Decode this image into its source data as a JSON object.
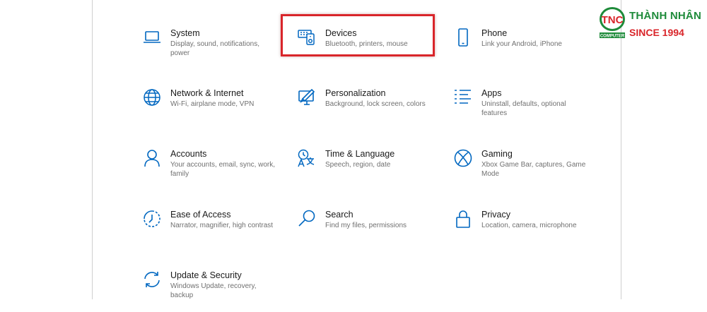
{
  "settings": {
    "items": [
      {
        "title": "System",
        "subtitle": "Display, sound, notifications, power",
        "icon": "laptop-icon"
      },
      {
        "title": "Devices",
        "subtitle": "Bluetooth, printers, mouse",
        "icon": "devices-icon"
      },
      {
        "title": "Phone",
        "subtitle": "Link your Android, iPhone",
        "icon": "phone-icon"
      },
      {
        "title": "Network & Internet",
        "subtitle": "Wi-Fi, airplane mode, VPN",
        "icon": "globe-icon"
      },
      {
        "title": "Personalization",
        "subtitle": "Background, lock screen, colors",
        "icon": "paint-brush-icon"
      },
      {
        "title": "Apps",
        "subtitle": "Uninstall, defaults, optional features",
        "icon": "apps-list-icon"
      },
      {
        "title": "Accounts",
        "subtitle": "Your accounts, email, sync, work, family",
        "icon": "person-icon"
      },
      {
        "title": "Time & Language",
        "subtitle": "Speech, region, date",
        "icon": "time-language-icon"
      },
      {
        "title": "Gaming",
        "subtitle": "Xbox Game Bar, captures, Game Mode",
        "icon": "xbox-icon"
      },
      {
        "title": "Ease of Access",
        "subtitle": "Narrator, magnifier, high contrast",
        "icon": "ease-of-access-icon"
      },
      {
        "title": "Search",
        "subtitle": "Find my files, permissions",
        "icon": "search-icon"
      },
      {
        "title": "Privacy",
        "subtitle": "Location, camera, microphone",
        "icon": "lock-icon"
      },
      {
        "title": "Update & Security",
        "subtitle": "Windows Update, recovery, backup",
        "icon": "refresh-icon"
      }
    ]
  },
  "highlighted_item": "Devices",
  "logo": {
    "mark": "TNC",
    "mark_small": "COMPUTER",
    "brand": "THÀNH NHÂN",
    "since": "SINCE 1994"
  },
  "colors": {
    "icon": "#0067c0",
    "highlight": "#d9252a",
    "brand_green": "#1e8b3a",
    "brand_red": "#d9252a"
  }
}
